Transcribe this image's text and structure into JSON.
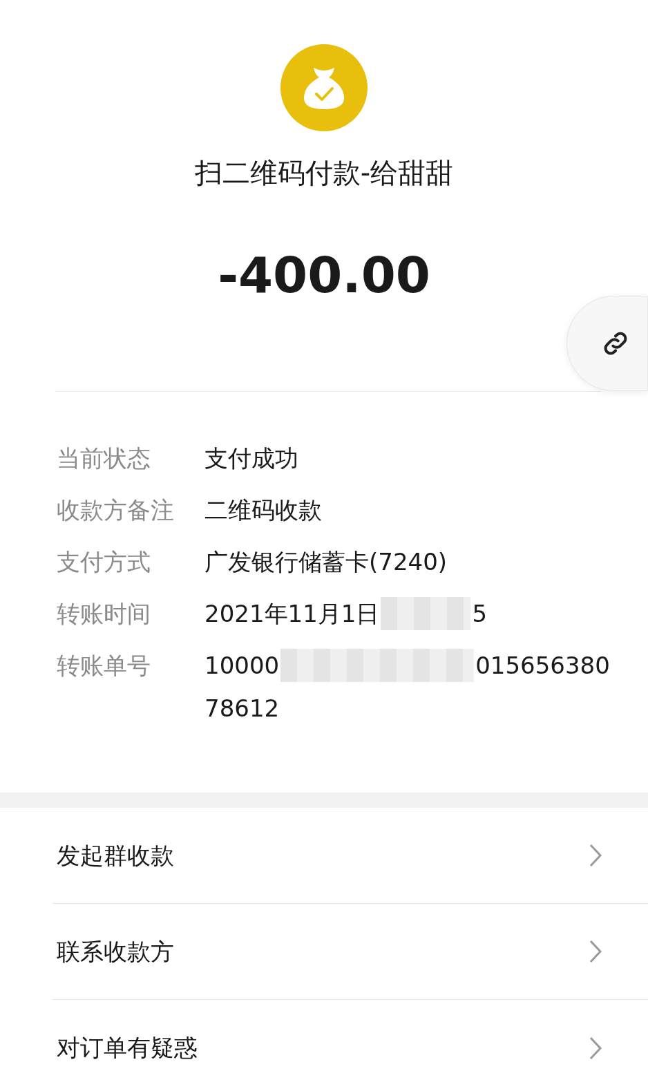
{
  "title": "扫二维码付款-给甜甜",
  "amount": "-400.00",
  "details": [
    {
      "label": "当前状态",
      "parts": [
        {
          "kind": "text",
          "text": "支付成功"
        }
      ]
    },
    {
      "label": "收款方备注",
      "parts": [
        {
          "kind": "text",
          "text": "二维码收款"
        }
      ]
    },
    {
      "label": "支付方式",
      "parts": [
        {
          "kind": "text",
          "text": "广发银行储蓄卡(7240)"
        }
      ]
    },
    {
      "label": "转账时间",
      "parts": [
        {
          "kind": "text",
          "text": "2021年11月1日"
        },
        {
          "kind": "redacted"
        },
        {
          "kind": "text",
          "text": "5"
        }
      ]
    },
    {
      "label": "转账单号",
      "parts": [
        {
          "kind": "text",
          "text": "10000"
        },
        {
          "kind": "redacted"
        },
        {
          "kind": "text",
          "text": "015656380"
        },
        {
          "kind": "line_break"
        },
        {
          "kind": "text",
          "text": "78612"
        }
      ]
    }
  ],
  "actions": [
    {
      "label": "发起群收款"
    },
    {
      "label": "联系收款方"
    },
    {
      "label": "对订单有疑惑"
    }
  ]
}
